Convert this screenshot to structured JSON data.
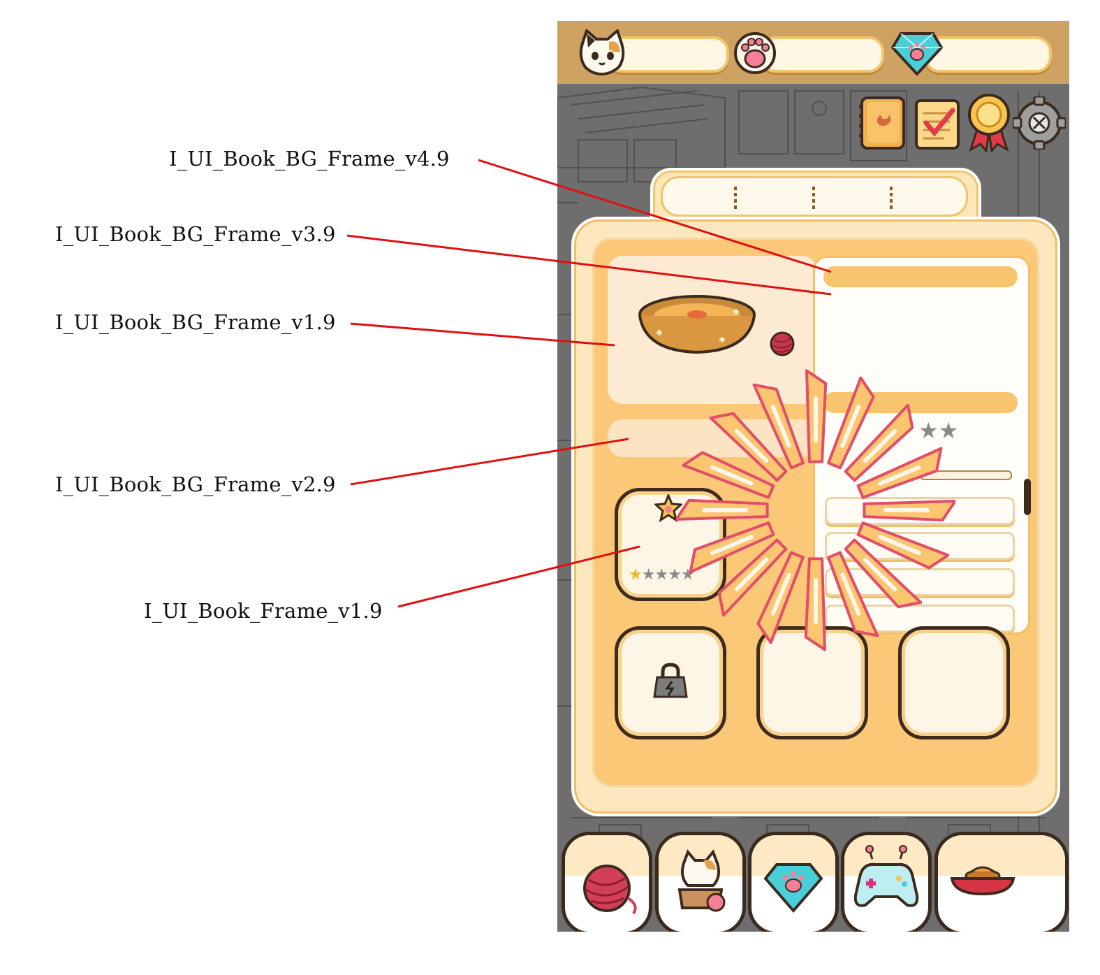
{
  "annotations": [
    {
      "id": "v4",
      "text": "I_UI_Book_BG_Frame_v4.9"
    },
    {
      "id": "v3",
      "text": "I_UI_Book_BG_Frame_v3.9"
    },
    {
      "id": "v1",
      "text": "I_UI_Book_BG_Frame_v1.9"
    },
    {
      "id": "v2",
      "text": "I_UI_Book_BG_Frame_v2.9"
    },
    {
      "id": "frame",
      "text": "I_UI_Book_Frame_v1.9"
    }
  ],
  "colors": {
    "leader_line": "#e01010",
    "topbar": "#cda262",
    "book_fill": "#fbc877",
    "panel_accent": "#f8c56f",
    "burst_stroke": "#e24d68",
    "burst_fill": "#fcc56f"
  },
  "topbar": {
    "resources": [
      {
        "icon": "cat-face-icon",
        "value": ""
      },
      {
        "icon": "paw-icon",
        "value": ""
      },
      {
        "icon": "diamond-paw-icon",
        "value": ""
      }
    ]
  },
  "hud": [
    "cat-book-icon",
    "checklist-icon",
    "award-ribbon-icon",
    "settings-gear-icon"
  ],
  "book": {
    "tabs": [
      "",
      "",
      "",
      ""
    ],
    "item_stars": {
      "filled": 1,
      "total": 5
    },
    "detail_stars": {
      "filled": 0,
      "total": 2
    },
    "slots": [
      {
        "icon": "star-paw-badge-icon",
        "locked": false
      },
      {
        "icon": "lock-icon",
        "locked": true
      },
      {
        "icon": "",
        "locked": false
      },
      {
        "icon": "",
        "locked": false
      }
    ],
    "preview_icons": [
      "cat-bed-icon",
      "yarn-ball-icon"
    ]
  },
  "bottom_nav": [
    {
      "icon": "yarn-ball-icon"
    },
    {
      "icon": "cat-in-box-icon"
    },
    {
      "icon": "diamond-paw-icon"
    },
    {
      "icon": "gamepad-icon"
    },
    {
      "icon": "food-bowl-icon"
    }
  ]
}
